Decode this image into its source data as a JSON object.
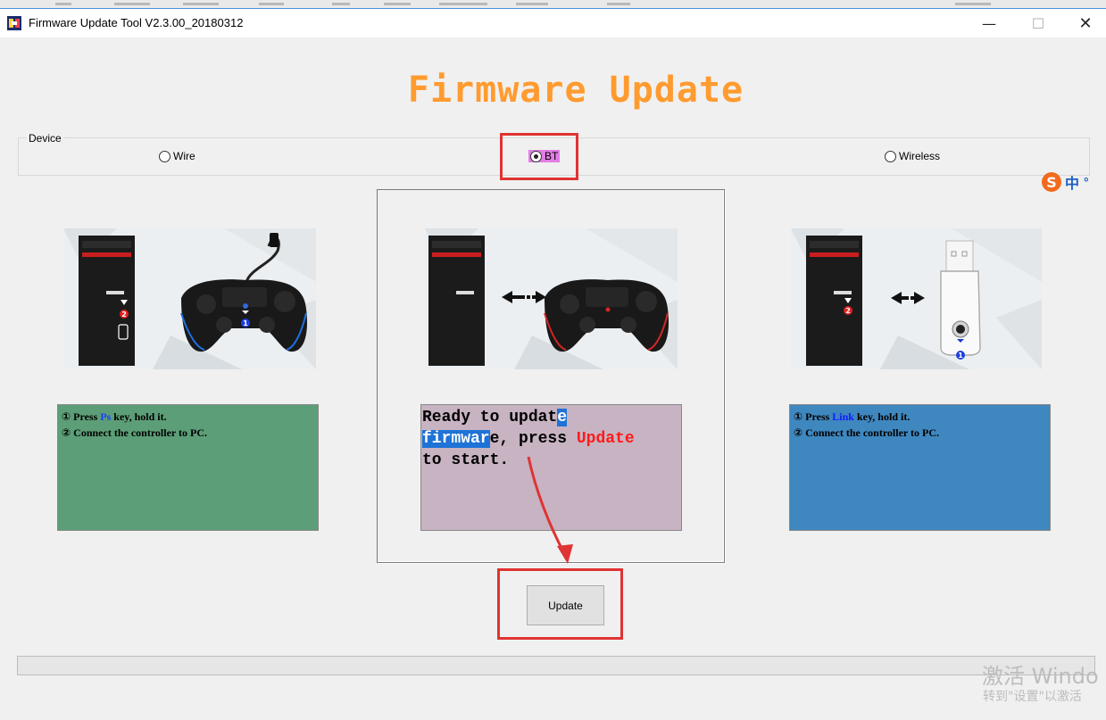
{
  "window": {
    "title": "Firmware Update Tool V2.3.00_20180312",
    "minimize_glyph": "—",
    "maximize_glyph": "☐",
    "close_glyph": "✕"
  },
  "headline": "Firmware Update",
  "device_group": {
    "legend": "Device",
    "options": [
      {
        "label": "Wire",
        "selected": false
      },
      {
        "label": "BT",
        "selected": true
      },
      {
        "label": "Wireless",
        "selected": false
      }
    ]
  },
  "ime": {
    "logo_glyph": "S",
    "mode": "中",
    "punct": "°"
  },
  "panels": {
    "wire_note": {
      "line1_num": "①",
      "line1_pre": " Press ",
      "line1_key": "Ps",
      "line1_post": " key, hold it.",
      "line2_num": "②",
      "line2_text": " Connect the controller to PC."
    },
    "bt_status": {
      "part1": "Ready to updat",
      "part2_selected": "e\nfirmwar",
      "part3": "e, press ",
      "part4_red": "Update",
      "part5": "\nto start."
    },
    "wireless_note": {
      "line1_num": "①",
      "line1_pre": " Press ",
      "line1_key": "Link",
      "line1_post": " key, hold it.",
      "line2_num": "②",
      "line2_text": " Connect the controller to PC."
    }
  },
  "illustration_labels": {
    "one": "1",
    "two": "2"
  },
  "update_button": "Update",
  "progress": {
    "value": 0
  },
  "watermark": {
    "line1": "激活 Windo",
    "line2": "转到\"设置\"以激活"
  },
  "colors": {
    "headline": "#ff9b2f",
    "annotation_red": "#e03333",
    "green_note": "#5c9e77",
    "blue_note": "#3f87bf",
    "status_bg": "#c7b3c2"
  }
}
